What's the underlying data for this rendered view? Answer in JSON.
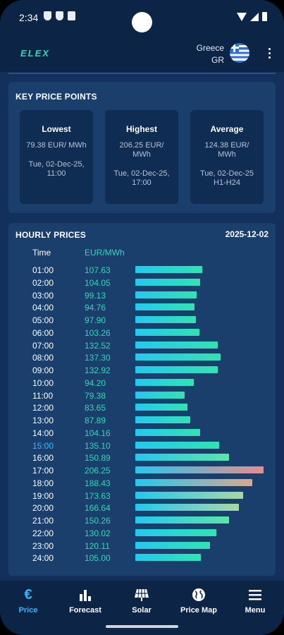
{
  "status": {
    "time": "2:34"
  },
  "app": {
    "logo": "ELEX",
    "country": "Greece",
    "country_code": "GR",
    "menu_icon": "kebab-icon"
  },
  "colors": {
    "accent": "#2fd9b3",
    "active": "#36b7ff",
    "background": "#12305b",
    "card": "#1a3f6d"
  },
  "key_price_points": {
    "title": "KEY PRICE POINTS",
    "cards": [
      {
        "label": "Lowest",
        "value": "79.38  EUR/ MWh",
        "date": "Tue, 02-Dec-25, 11:00"
      },
      {
        "label": "Highest",
        "value": "206.25  EUR/ MWh",
        "date": "Tue, 02-Dec-25, 17:00"
      },
      {
        "label": "Average",
        "value": "124.38  EUR/ MWh",
        "date": "Tue, 02-Dec-25 H1-H24"
      }
    ]
  },
  "hourly": {
    "title": "HOURLY PRICES",
    "date": "2025-12-02",
    "col_time": "Time",
    "col_unit": "EUR/MWh",
    "current_hour": "15:00",
    "max_value": 206.25,
    "rows": [
      {
        "time": "01:00",
        "value": "107.63"
      },
      {
        "time": "02:00",
        "value": "104.05"
      },
      {
        "time": "03:00",
        "value": "99.13"
      },
      {
        "time": "04:00",
        "value": "94.76"
      },
      {
        "time": "05:00",
        "value": "97.90"
      },
      {
        "time": "06:00",
        "value": "103.26"
      },
      {
        "time": "07:00",
        "value": "132.52"
      },
      {
        "time": "08:00",
        "value": "137.30"
      },
      {
        "time": "09:00",
        "value": "132.92"
      },
      {
        "time": "10:00",
        "value": "94.20"
      },
      {
        "time": "11:00",
        "value": "79.38"
      },
      {
        "time": "12:00",
        "value": "83.65"
      },
      {
        "time": "13:00",
        "value": "87.89"
      },
      {
        "time": "14:00",
        "value": "104.16"
      },
      {
        "time": "15:00",
        "value": "135.10"
      },
      {
        "time": "16:00",
        "value": "150.89"
      },
      {
        "time": "17:00",
        "value": "206.25"
      },
      {
        "time": "18:00",
        "value": "188.43"
      },
      {
        "time": "19:00",
        "value": "173.63"
      },
      {
        "time": "20:00",
        "value": "166.64"
      },
      {
        "time": "21:00",
        "value": "150.26"
      },
      {
        "time": "22:00",
        "value": "130.02"
      },
      {
        "time": "23:00",
        "value": "120.11"
      },
      {
        "time": "24:00",
        "value": "105.00"
      }
    ]
  },
  "nav": [
    {
      "label": "Price",
      "icon": "euro-icon",
      "active": true
    },
    {
      "label": "Forecast",
      "icon": "bar-chart-icon",
      "active": false
    },
    {
      "label": "Solar",
      "icon": "solar-panel-icon",
      "active": false
    },
    {
      "label": "Price Map",
      "icon": "globe-icon",
      "active": false
    },
    {
      "label": "Menu",
      "icon": "hamburger-icon",
      "active": false
    }
  ]
}
